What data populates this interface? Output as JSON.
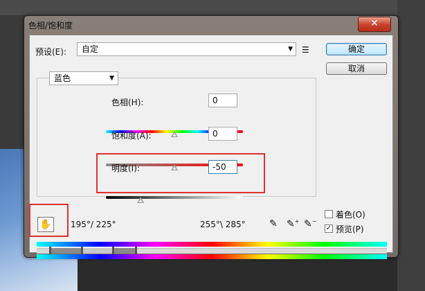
{
  "dialog": {
    "title": "色相/饱和度"
  },
  "preset": {
    "label": "预设(E):",
    "value": "自定"
  },
  "buttons": {
    "ok": "确定",
    "cancel": "取消"
  },
  "channel": {
    "value": "蓝色"
  },
  "hue": {
    "label": "色相(H):",
    "value": "0",
    "fraction": 0.5
  },
  "saturation": {
    "label": "饱和度(A):",
    "value": "0",
    "fraction": 0.5
  },
  "lightness": {
    "label": "明度(I):",
    "value": "-50",
    "fraction": 0.25
  },
  "range": {
    "left": "195°/ 225°",
    "right": "255°\\ 285°"
  },
  "options": {
    "colorize": "着色(O)",
    "preview": "预览(P)",
    "colorize_checked": false,
    "preview_checked": true
  },
  "colors": {
    "accent_highlight": "#e03030",
    "ok_border": "#3c7fb1"
  },
  "icons": {
    "close": "close-icon",
    "hand": "hand-icon",
    "eyedropper": "eyedropper-icon",
    "eyedropper_plus": "eyedropper-plus-icon",
    "eyedropper_minus": "eyedropper-minus-icon",
    "preset_menu": "preset-menu-icon"
  }
}
